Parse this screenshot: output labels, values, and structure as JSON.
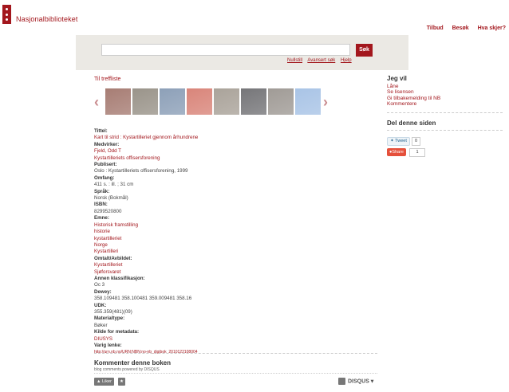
{
  "header": {
    "logo_text": "Nasjonalbiblioteket",
    "nav": [
      "Tilbud",
      "Besøk",
      "Hva skjer?"
    ]
  },
  "search": {
    "value": "",
    "button": "Søk",
    "links": [
      "Nullstill",
      "Avansert søk",
      "Hjelp"
    ]
  },
  "main": {
    "back_link": "Til treffliste",
    "thumb_colors": [
      "#a77d74",
      "#9a948a",
      "#8da0b8",
      "#d9857a",
      "#aaa39a",
      "#767679",
      "#a09b96",
      "#a9c4e6"
    ],
    "fields": [
      {
        "label": "Tittel:",
        "values": [
          "Kart til strid : Kystartilleriet gjennom århundrene"
        ],
        "link": true
      },
      {
        "label": "Medvirker:",
        "values": [
          "Fjeld, Odd T",
          "Kystartilleriets offisersforening"
        ],
        "link": true
      },
      {
        "label": "Publisert:",
        "values": [
          "Oslo : Kystartilleriets offisersforening, 1999"
        ],
        "link": false
      },
      {
        "label": "Omfang:",
        "values": [
          "411 s. : ill. ; 31 cm"
        ],
        "link": false
      },
      {
        "label": "Språk:",
        "values": [
          "Norsk (Bokmål)"
        ],
        "link": false
      },
      {
        "label": "ISBN:",
        "values": [
          "8299520800"
        ],
        "link": false
      },
      {
        "label": "Emne:",
        "values": [
          "Historisk framstilling",
          "historie",
          "kystartilleriet",
          "Norge",
          "Kystartilleri"
        ],
        "link": true
      },
      {
        "label": "Omtalt/Avbildet:",
        "values": [
          "Kystartilleriet",
          "Sjøforsvaret"
        ],
        "link": true
      },
      {
        "label": "Annen klassifikasjon:",
        "values": [
          "Oc 3"
        ],
        "link": false
      },
      {
        "label": "Dewey:",
        "values": [
          "358.109481 358.100481 359.009481 358.16"
        ],
        "link": false
      },
      {
        "label": "UDK:",
        "values": [
          "355.359(481)(09)"
        ],
        "link": false
      },
      {
        "label": "Materialtype:",
        "values": [
          "Bøker"
        ],
        "link": false
      },
      {
        "label": "Kilde for metadata:",
        "values": [
          "DIUSYS"
        ],
        "link": true
      },
      {
        "label": "Varig lenke:",
        "values": [
          "http://urn.nb.no/URN:NBN:no-nb_digibok_2010122108004"
        ],
        "link": true,
        "small": true
      }
    ],
    "comments": {
      "title": "Kommenter denne boken",
      "subtitle": "blog comments powered by DISQUS",
      "like_label": "Liker",
      "disqus_label": "DISQUS"
    }
  },
  "side": {
    "jeg_vil_title": "Jeg vil",
    "jeg_vil_links": [
      "Låne",
      "Se lisensen",
      "Gi tilbakemelding til NB",
      "Kommentere"
    ],
    "share_title": "Del denne siden",
    "tweet_label": "Tweet",
    "tweet_count": "0",
    "share_label": "Share",
    "share_count": "1"
  },
  "colors": {
    "brand": "#a3171d",
    "band": "#ebe9e4"
  }
}
